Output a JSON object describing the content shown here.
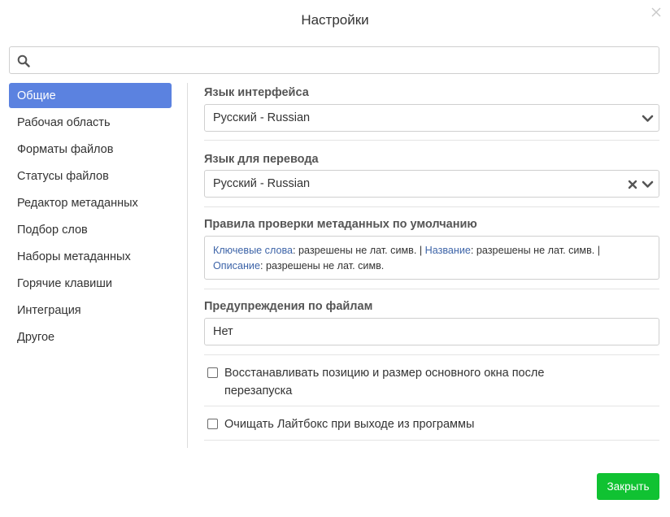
{
  "dialog": {
    "title": "Настройки"
  },
  "search": {
    "value": "",
    "placeholder": ""
  },
  "sidebar": {
    "items": [
      {
        "label": "Общие",
        "active": true
      },
      {
        "label": "Рабочая область"
      },
      {
        "label": "Форматы файлов"
      },
      {
        "label": "Статусы файлов"
      },
      {
        "label": "Редактор метаданных"
      },
      {
        "label": "Подбор слов"
      },
      {
        "label": "Наборы метаданных"
      },
      {
        "label": "Горячие клавиши"
      },
      {
        "label": "Интеграция"
      },
      {
        "label": "Другое"
      }
    ]
  },
  "general": {
    "interface_language": {
      "label": "Язык интерфейса",
      "value": "Русский - Russian"
    },
    "translation_language": {
      "label": "Язык для перевода",
      "value": "Русский - Russian"
    },
    "metadata_rules": {
      "label": "Правила проверки метаданных по умолчанию",
      "keywords_key": "Ключевые слова",
      "keywords_value": ": разрешены не лат. симв. |",
      "title_key": "Название",
      "title_value": ": разрешены не лат. симв. |",
      "description_key": "Описание",
      "description_value": ": разрешены не лат. симв."
    },
    "file_warnings": {
      "label": "Предупреждения по файлам",
      "value": "Нет"
    },
    "restore_window": {
      "label": "Восстанавливать позицию и размер основного окна после перезапуска",
      "checked": false
    },
    "clear_lightbox": {
      "label": "Очищать Лайтбокс при выходе из программы",
      "checked": false
    }
  },
  "footer": {
    "close_label": "Закрыть"
  },
  "icons": {
    "search": "search-icon",
    "close": "close-icon",
    "chevron": "chevron-down-icon",
    "clear": "clear-icon"
  },
  "colors": {
    "accent": "#5b82e0",
    "link": "#3d64a8",
    "primary_button": "#10c232"
  }
}
